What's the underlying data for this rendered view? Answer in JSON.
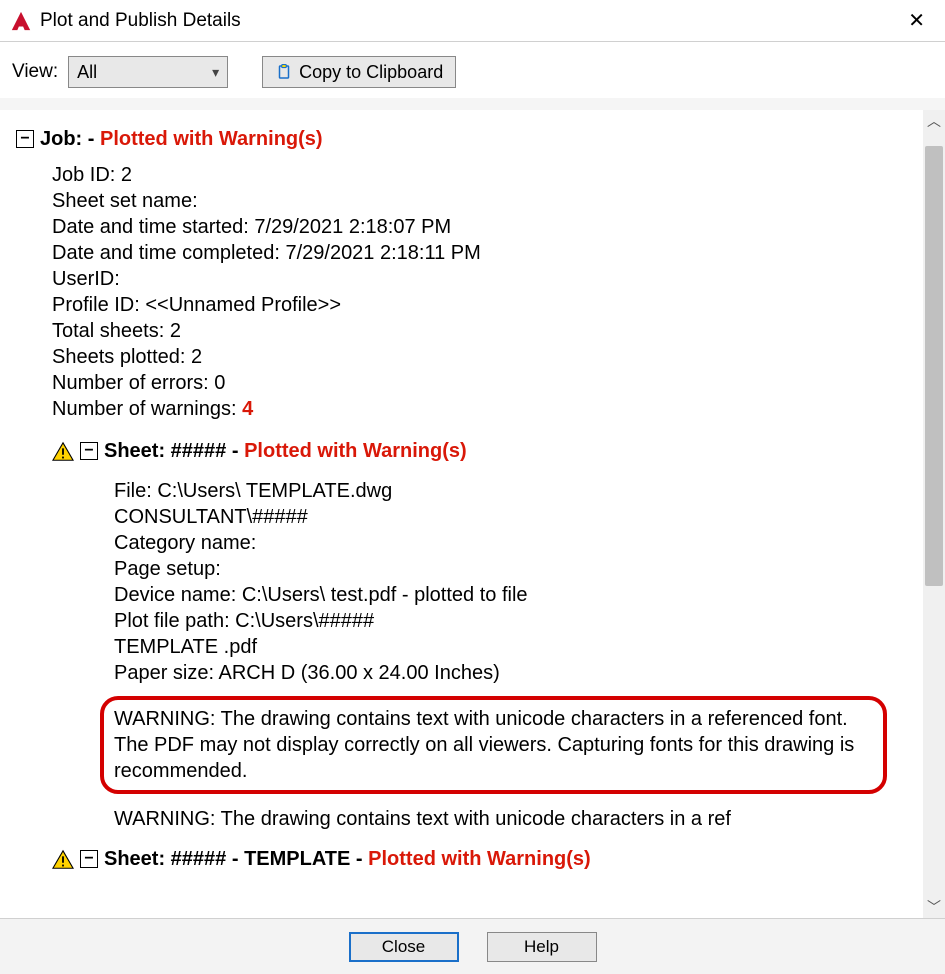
{
  "title": "Plot and Publish Details",
  "toolbar": {
    "view_label": "View:",
    "view_value": "All",
    "copy_label": "Copy to Clipboard"
  },
  "job": {
    "header_prefix": "Job: - ",
    "header_status": "Plotted with Warning(s)",
    "lines": [
      "Job ID: 2",
      "Sheet set name:",
      "Date and time started: 7/29/2021 2:18:07 PM",
      "Date and time completed: 7/29/2021 2:18:11 PM",
      "UserID:",
      "Profile ID: <<Unnamed Profile>>",
      "Total sheets: 2",
      "Sheets plotted: 2",
      "Number of errors: 0"
    ],
    "warnings_label": "Number of warnings: ",
    "warnings_count": "4"
  },
  "sheet1": {
    "title_prefix": "Sheet: #####  - ",
    "title_status": "Plotted with Warning(s)",
    "lines": [
      "File: C:\\Users\\ TEMPLATE.dwg",
      "CONSULTANT\\#####",
      "Category name:",
      "Page setup:",
      "Device name: C:\\Users\\ test.pdf - plotted to file",
      "Plot file path: C:\\Users\\#####",
      "TEMPLATE .pdf",
      "Paper size: ARCH D (36.00 x 24.00 Inches)"
    ],
    "warning_highlight": "WARNING: The drawing contains text with unicode characters in a referenced font. The PDF may not display correctly on all viewers. Capturing fonts for this drawing is recommended.",
    "warning_trunc": "WARNING: The drawing contains text with unicode characters in a ref"
  },
  "sheet2": {
    "title_prefix": "Sheet: ##### - TEMPLATE - ",
    "title_status": "Plotted with Warning(s)"
  },
  "footer": {
    "close": "Close",
    "help": "Help"
  }
}
